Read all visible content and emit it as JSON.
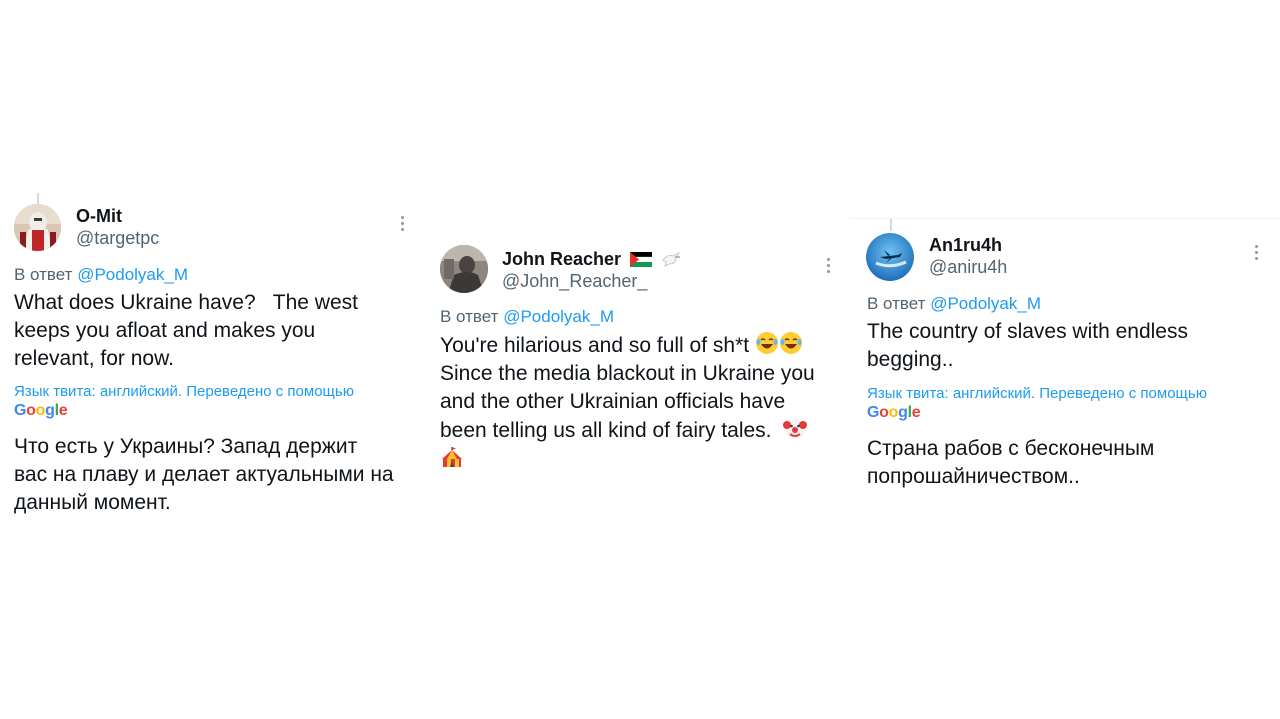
{
  "tweets": [
    {
      "name": "O-Mit",
      "handle": "@targetpc",
      "reply_prefix": "В ответ",
      "reply_to": "@Podolyak_M",
      "text_lines": [
        "What does Ukraine have?   The west",
        "keeps you afloat and makes you",
        "relevant, for now."
      ],
      "translate_note": "Язык твита: английский. Переведено с помощью",
      "translate_provider": "Google",
      "translation_lines": [
        "Что есть у Украины? Запад держит",
        "вас на плаву и делает актуальными на",
        "данный момент."
      ]
    },
    {
      "name": "John Reacher",
      "handle": "@John_Reacher_",
      "reply_prefix": "В ответ",
      "reply_to": "@Podolyak_M",
      "text_lines": [
        "You're hilarious and so full of sh*t",
        "Since the media blackout in Ukraine you",
        "and the other Ukrainian officials have",
        "been telling us all kind of fairy tales."
      ]
    },
    {
      "name": "An1ru4h",
      "handle": "@aniru4h",
      "reply_prefix": "В ответ",
      "reply_to": "@Podolyak_M",
      "text_lines": [
        "The country of slaves with endless",
        "begging.."
      ],
      "translate_note": "Язык твита: английский. Переведено с помощью",
      "translate_provider": "Google",
      "translation_lines": [
        "Страна рабов с бесконечным",
        "попрошайничеством.."
      ]
    }
  ],
  "colors": {
    "link": "#1d9bf0",
    "secondary_text": "#536471",
    "primary_text": "#0f1419"
  },
  "icons": [
    "more-options-icon",
    "palestine-flag-icon",
    "dove-icon",
    "laughing-emoji-icon",
    "clown-emoji-icon",
    "circus-tent-emoji-icon",
    "google-logo"
  ]
}
